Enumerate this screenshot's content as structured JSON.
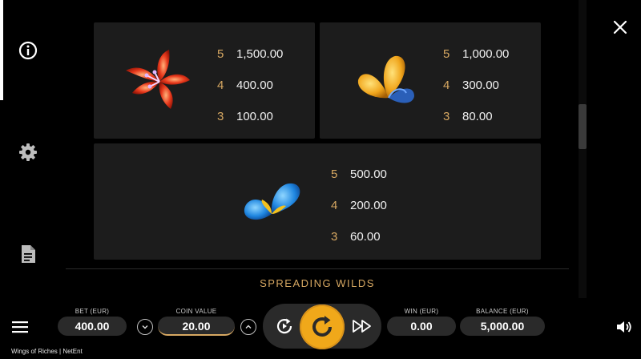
{
  "sidebar": {
    "items": [
      {
        "name": "info",
        "icon": "info-icon",
        "active": true
      },
      {
        "name": "settings",
        "icon": "gear-icon",
        "active": false
      },
      {
        "name": "rules",
        "icon": "document-icon",
        "active": false
      }
    ]
  },
  "close": {
    "icon": "close-icon"
  },
  "paytable": {
    "symbols": [
      {
        "icon": "red-flower-icon",
        "pays": [
          {
            "count": "5",
            "value": "1,500.00"
          },
          {
            "count": "4",
            "value": "400.00"
          },
          {
            "count": "3",
            "value": "100.00"
          }
        ]
      },
      {
        "icon": "golden-petal-icon",
        "pays": [
          {
            "count": "5",
            "value": "1,000.00"
          },
          {
            "count": "4",
            "value": "300.00"
          },
          {
            "count": "3",
            "value": "80.00"
          }
        ]
      },
      {
        "icon": "blue-petal-icon",
        "pays": [
          {
            "count": "5",
            "value": "500.00"
          },
          {
            "count": "4",
            "value": "200.00"
          },
          {
            "count": "3",
            "value": "60.00"
          }
        ]
      }
    ],
    "section_title": "SPREADING WILDS"
  },
  "controls": {
    "bet": {
      "label": "BET (EUR)",
      "value": "400.00"
    },
    "coin_value": {
      "label": "COIN VALUE",
      "value": "20.00"
    },
    "win": {
      "label": "WIN (EUR)",
      "value": "0.00"
    },
    "balance": {
      "label": "BALANCE (EUR)",
      "value": "5,000.00"
    }
  },
  "footer": {
    "game": "Wings of Riches",
    "separator": "|",
    "provider": "NetEnt"
  },
  "colors": {
    "accent": "#d7a862",
    "spin": "#f0a81a",
    "panel": "#1c1c1c"
  }
}
